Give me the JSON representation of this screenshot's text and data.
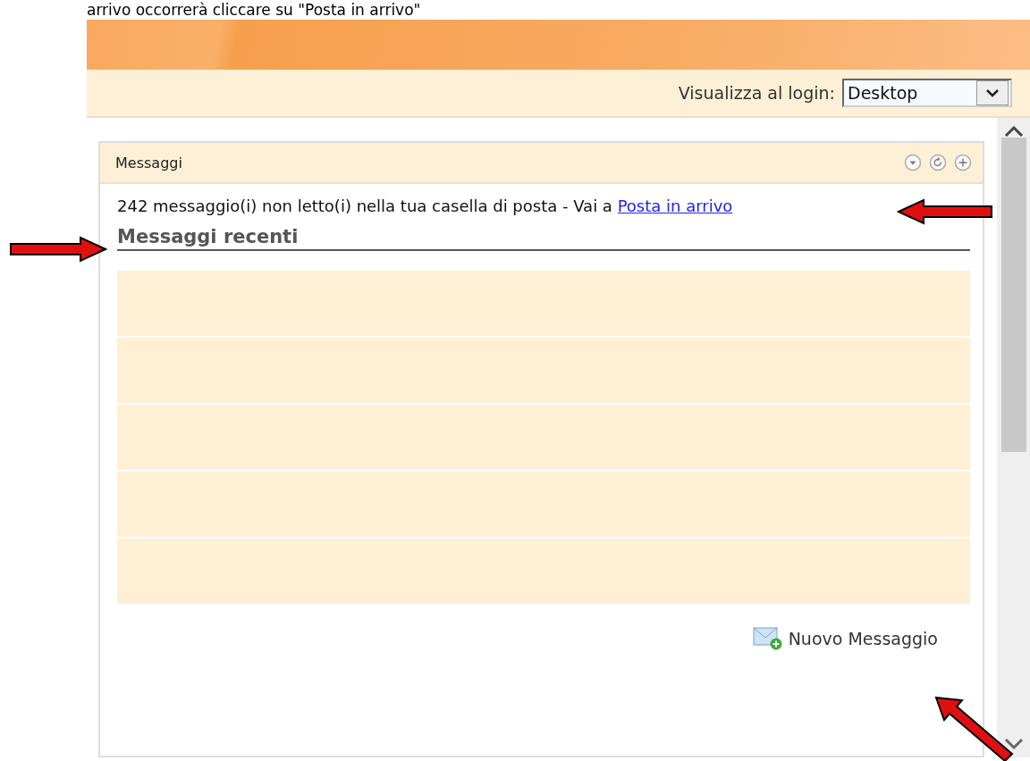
{
  "caption": "arrivo occorrerà cliccare su \"Posta in arrivo\"",
  "toolbar": {
    "label": "Visualizza al login:",
    "select_value": "Desktop"
  },
  "panel": {
    "title": "Messaggi",
    "unread_text": "242 messaggio(i) non letto(i) nella tua casella di posta - Vai a",
    "inbox_link": "Posta in arrivo",
    "section_title": "Messaggi recenti",
    "new_message": "Nuovo Messaggio"
  }
}
